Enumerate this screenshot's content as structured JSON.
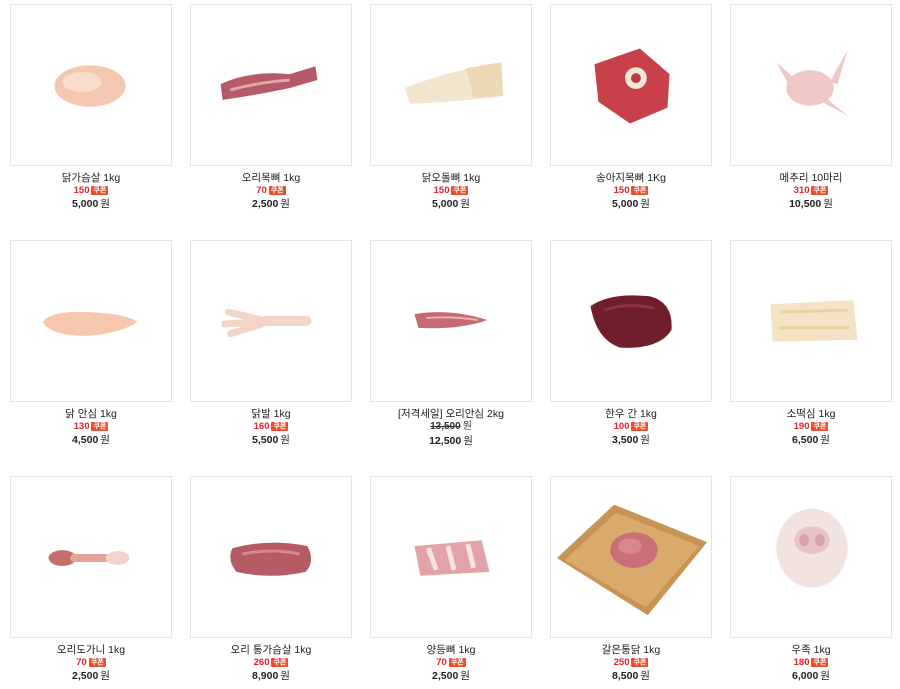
{
  "products": [
    {
      "name": "닭가슴살 1kg",
      "points": "150",
      "coupon": "쿠폰",
      "price": "5,000",
      "won": "원"
    },
    {
      "name": "오리목뼈 1kg",
      "points": "70",
      "coupon": "쿠폰",
      "price": "2,500",
      "won": "원"
    },
    {
      "name": "닭오돌뼈 1kg",
      "points": "150",
      "coupon": "쿠폰",
      "price": "5,000",
      "won": "원"
    },
    {
      "name": "송아지목뼈 1Kg",
      "points": "150",
      "coupon": "쿠폰",
      "price": "5,000",
      "won": "원"
    },
    {
      "name": "메추리 10마리",
      "points": "310",
      "coupon": "쿠폰",
      "price": "10,500",
      "won": "원"
    },
    {
      "name": "닭 안심 1kg",
      "points": "130",
      "coupon": "쿠폰",
      "price": "4,500",
      "won": "원"
    },
    {
      "name": "닭발 1kg",
      "points": "160",
      "coupon": "쿠폰",
      "price": "5,500",
      "won": "원"
    },
    {
      "name": "[저격세일] 오리안심 2kg",
      "original_price": "13,500",
      "price": "12,500",
      "won": "원"
    },
    {
      "name": "한우 간 1kg",
      "points": "100",
      "coupon": "쿠폰",
      "price": "3,500",
      "won": "원"
    },
    {
      "name": "소떡심 1kg",
      "points": "190",
      "coupon": "쿠폰",
      "price": "6,500",
      "won": "원"
    },
    {
      "name": "오리도가니 1kg",
      "points": "70",
      "coupon": "쿠폰",
      "price": "2,500",
      "won": "원"
    },
    {
      "name": "오리 통가슴살 1kg",
      "points": "260",
      "coupon": "쿠폰",
      "price": "8,900",
      "won": "원"
    },
    {
      "name": "양등뼈 1kg",
      "points": "70",
      "coupon": "쿠폰",
      "price": "2,500",
      "won": "원"
    },
    {
      "name": "갈은통닭 1kg",
      "points": "250",
      "coupon": "쿠폰",
      "price": "8,500",
      "won": "원"
    },
    {
      "name": "우족 1kg",
      "points": "180",
      "coupon": "쿠폰",
      "price": "6,000",
      "won": "원"
    }
  ],
  "image_names": [
    "chicken-breast-image",
    "duck-neck-bone-image",
    "chicken-cartilage-image",
    "veal-neck-bone-image",
    "quail-image",
    "chicken-tenderloin-image",
    "chicken-feet-image",
    "duck-tenderloin-image",
    "beef-liver-image",
    "beef-tendon-image",
    "duck-knee-image",
    "duck-breast-image",
    "lamb-back-bone-image",
    "ground-chicken-image",
    "ox-feet-image"
  ]
}
